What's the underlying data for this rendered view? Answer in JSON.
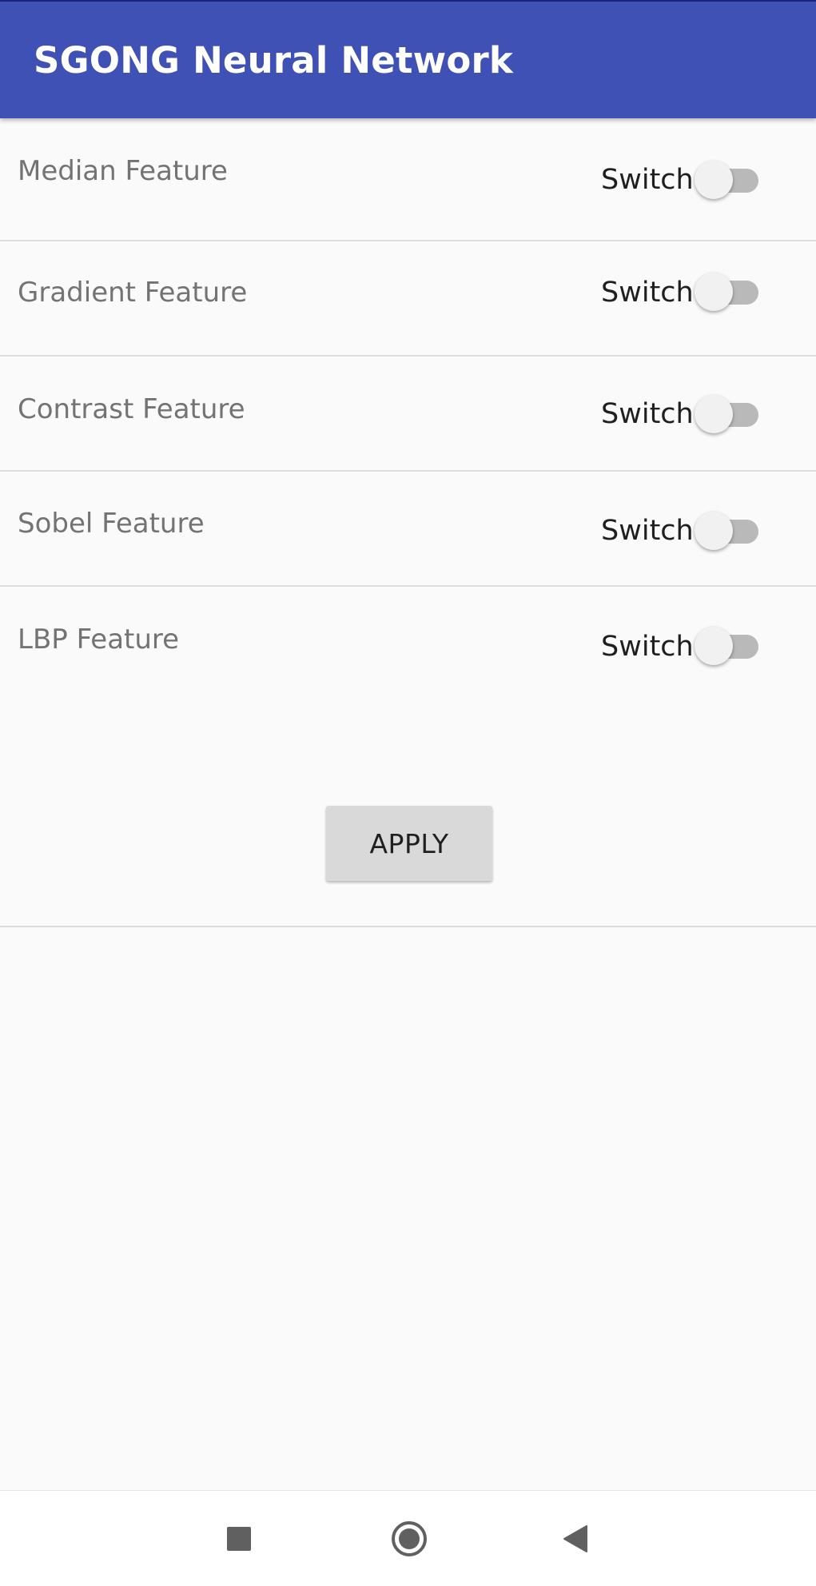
{
  "app_bar": {
    "title": "SGONG Neural Network",
    "color": "#3f51b5"
  },
  "features": [
    {
      "label": "Median Feature",
      "switch_text": "Switch",
      "checked": false
    },
    {
      "label": "Gradient Feature",
      "switch_text": "Switch",
      "checked": false
    },
    {
      "label": "Contrast Feature",
      "switch_text": "Switch",
      "checked": false
    },
    {
      "label": "Sobel Feature",
      "switch_text": "Switch",
      "checked": false
    },
    {
      "label": "LBP Feature",
      "switch_text": "Switch",
      "checked": false
    }
  ],
  "apply_button": {
    "label": "APPLY"
  },
  "nav_bar": {
    "buttons": [
      {
        "icon": "recents-square-icon"
      },
      {
        "icon": "home-circle-icon"
      },
      {
        "icon": "back-triangle-icon"
      }
    ]
  },
  "colors": {
    "background": "#fafafa",
    "switch_track_off": "#b9b9b9",
    "switch_thumb_off": "#f1f1f1",
    "label_text": "#737373",
    "button_bg": "#d9d9d9"
  }
}
